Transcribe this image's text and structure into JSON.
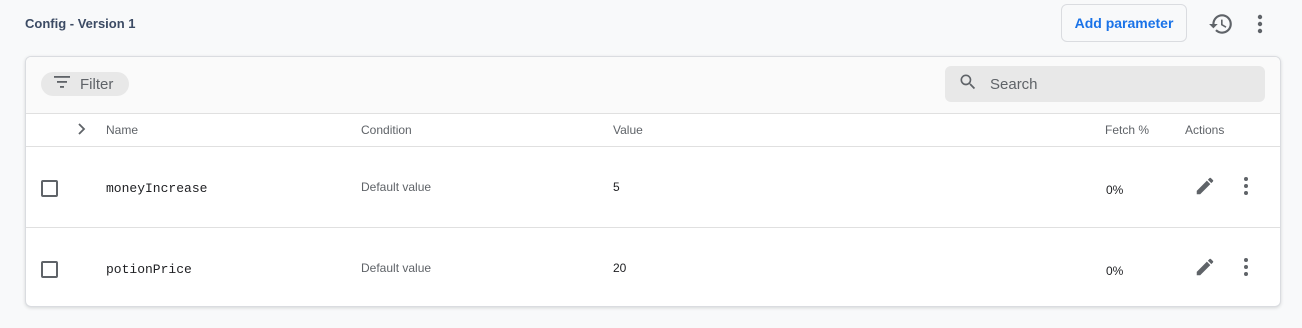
{
  "header": {
    "breadcrumb": "Config - Version 1",
    "add_parameter_label": "Add parameter",
    "history_icon": "history-icon",
    "more_icon": "more-vert-icon"
  },
  "toolbar": {
    "filter_label": "Filter",
    "filter_icon": "filter-icon",
    "search_placeholder": "Search",
    "search_value": "",
    "search_icon": "search-icon"
  },
  "table": {
    "columns": {
      "name": "Name",
      "condition": "Condition",
      "value": "Value",
      "fetch": "Fetch %",
      "actions": "Actions"
    },
    "rows": [
      {
        "name": "moneyIncrease",
        "condition": "Default value",
        "value": "5",
        "fetch": "0%"
      },
      {
        "name": "potionPrice",
        "condition": "Default value",
        "value": "20",
        "fetch": "0%"
      }
    ]
  },
  "colors": {
    "accent": "#1a73e8",
    "background": "#f8f9fa",
    "chip_background": "#e8e8e8",
    "icon": "#5f6368"
  }
}
